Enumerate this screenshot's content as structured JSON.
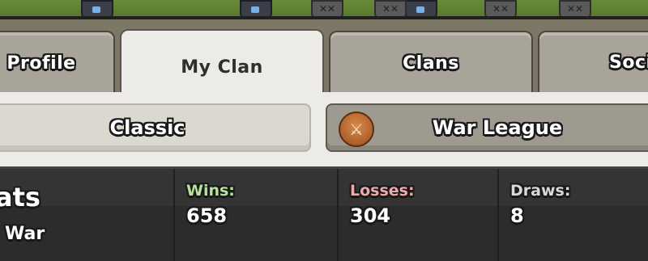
{
  "tabs": [
    {
      "label": "Profile",
      "active": false
    },
    {
      "label": "My Clan",
      "active": true
    },
    {
      "label": "Clans",
      "active": false
    },
    {
      "label": "Soci",
      "active": false
    }
  ],
  "subtabs": {
    "classic_label": "Classic",
    "war_league_label": "War League"
  },
  "clan": {
    "name_fragment": "ats",
    "subtitle_fragment": "War"
  },
  "stats": {
    "wins": {
      "label": "Wins:",
      "value": "658",
      "color": "#b6e39a"
    },
    "losses": {
      "label": "Losses:",
      "value": "304",
      "color": "#f0a8a8"
    },
    "draws": {
      "label": "Draws:",
      "value": "8",
      "color": "#d8d8d8"
    }
  }
}
